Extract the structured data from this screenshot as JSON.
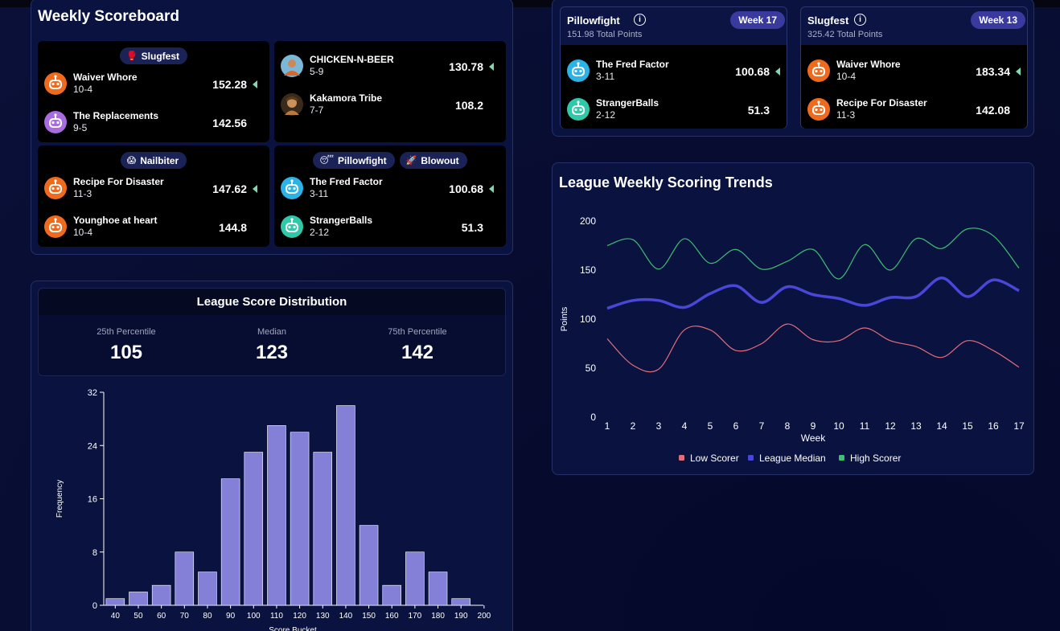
{
  "scoreboard": {
    "title": "Weekly Scoreboard",
    "matchups": [
      {
        "tags": [
          {
            "emoji": "🥊",
            "label": "Slugfest"
          }
        ],
        "teams": [
          {
            "name": "Waiver Whore",
            "record": "10-4",
            "score": "152.28",
            "winner": true,
            "avatar": "robot-orange"
          },
          {
            "name": "The Replacements",
            "record": "9-5",
            "score": "142.56",
            "winner": false,
            "avatar": "robot-purple"
          }
        ]
      },
      {
        "tags": [],
        "teams": [
          {
            "name": "CHICKEN-N-BEER",
            "record": "5-9",
            "score": "130.78",
            "winner": true,
            "avatar": "photo-person"
          },
          {
            "name": "Kakamora Tribe",
            "record": "7-7",
            "score": "108.2",
            "winner": false,
            "avatar": "photo-character"
          }
        ]
      },
      {
        "tags": [
          {
            "emoji": "😱",
            "label": "Nailbiter"
          }
        ],
        "teams": [
          {
            "name": "Recipe For Disaster",
            "record": "11-3",
            "score": "147.62",
            "winner": true,
            "avatar": "robot-orange"
          },
          {
            "name": "Younghoe at heart",
            "record": "10-4",
            "score": "144.8",
            "winner": false,
            "avatar": "robot-orange"
          }
        ]
      },
      {
        "tags": [
          {
            "emoji": "😴",
            "label": "Pillowfight"
          },
          {
            "emoji": "🚀",
            "label": "Blowout"
          }
        ],
        "teams": [
          {
            "name": "The Fred Factor",
            "record": "3-11",
            "score": "100.68",
            "winner": true,
            "avatar": "robot-blue"
          },
          {
            "name": "StrangerBalls",
            "record": "2-12",
            "score": "51.3",
            "winner": false,
            "avatar": "robot-teal"
          }
        ]
      }
    ]
  },
  "records": [
    {
      "title": "Pillowfight",
      "info_icon": "info-icon",
      "subtitle": "151.98 Total Points",
      "week": "Week 17",
      "teams": [
        {
          "name": "The Fred Factor",
          "record": "3-11",
          "score": "100.68",
          "winner": true,
          "avatar": "robot-blue"
        },
        {
          "name": "StrangerBalls",
          "record": "2-12",
          "score": "51.3",
          "winner": false,
          "avatar": "robot-teal"
        }
      ]
    },
    {
      "title": "Slugfest",
      "info_icon": "info-icon",
      "subtitle": "325.42 Total Points",
      "week": "Week 13",
      "teams": [
        {
          "name": "Waiver Whore",
          "record": "10-4",
          "score": "183.34",
          "winner": true,
          "avatar": "robot-orange"
        },
        {
          "name": "Recipe For Disaster",
          "record": "11-3",
          "score": "142.08",
          "winner": false,
          "avatar": "robot-orange"
        }
      ]
    }
  ],
  "distribution": {
    "title": "League Score Distribution",
    "stats": [
      {
        "label": "25th Percentile",
        "value": "105"
      },
      {
        "label": "Median",
        "value": "123"
      },
      {
        "label": "75th Percentile",
        "value": "142"
      }
    ]
  },
  "trends": {
    "title": "League Weekly Scoring Trends"
  },
  "colors": {
    "low": "#e26d7a",
    "median": "#4a46d8",
    "high": "#3fbf72",
    "bar": "#8480d8",
    "winner_arrow": "#7ed9b0",
    "robot-orange": "#f06a1e",
    "robot-purple": "#a86be0",
    "robot-blue": "#2bb3e6",
    "robot-teal": "#2fc9a9"
  },
  "chart_data": [
    {
      "type": "bar",
      "title": "",
      "xlabel": "Score Bucket",
      "ylabel": "Frequency",
      "categories": [
        "40",
        "50",
        "60",
        "70",
        "80",
        "90",
        "100",
        "110",
        "120",
        "130",
        "140",
        "150",
        "160",
        "170",
        "180",
        "190",
        "200"
      ],
      "values": [
        1,
        2,
        3,
        8,
        5,
        19,
        23,
        27,
        26,
        23,
        30,
        12,
        3,
        8,
        5,
        1,
        0
      ],
      "yticks": [
        0,
        8,
        16,
        24,
        32
      ],
      "ylim": [
        0,
        32
      ]
    },
    {
      "type": "line",
      "title": "",
      "xlabel": "Week",
      "ylabel": "Points",
      "x": [
        1,
        2,
        3,
        4,
        5,
        6,
        7,
        8,
        9,
        10,
        11,
        12,
        13,
        14,
        15,
        16,
        17
      ],
      "yticks": [
        0,
        50,
        100,
        150,
        200
      ],
      "ylim": [
        0,
        200
      ],
      "legend_position": "bottom",
      "series": [
        {
          "name": "Low Scorer",
          "color": "#e26d7a",
          "values": [
            80,
            53,
            49,
            89,
            89,
            68,
            75,
            95,
            79,
            78,
            91,
            78,
            72,
            61,
            78,
            68,
            51
          ]
        },
        {
          "name": "League Median",
          "color": "#4a46d8",
          "values": [
            111,
            119,
            119,
            112,
            126,
            134,
            117,
            133,
            125,
            121,
            114,
            122,
            123,
            142,
            123,
            140,
            129
          ]
        },
        {
          "name": "High Scorer",
          "color": "#3fbf72",
          "values": [
            175,
            181,
            151,
            182,
            157,
            171,
            151,
            159,
            171,
            141,
            176,
            150,
            182,
            172,
            192,
            185,
            152
          ]
        }
      ]
    }
  ]
}
